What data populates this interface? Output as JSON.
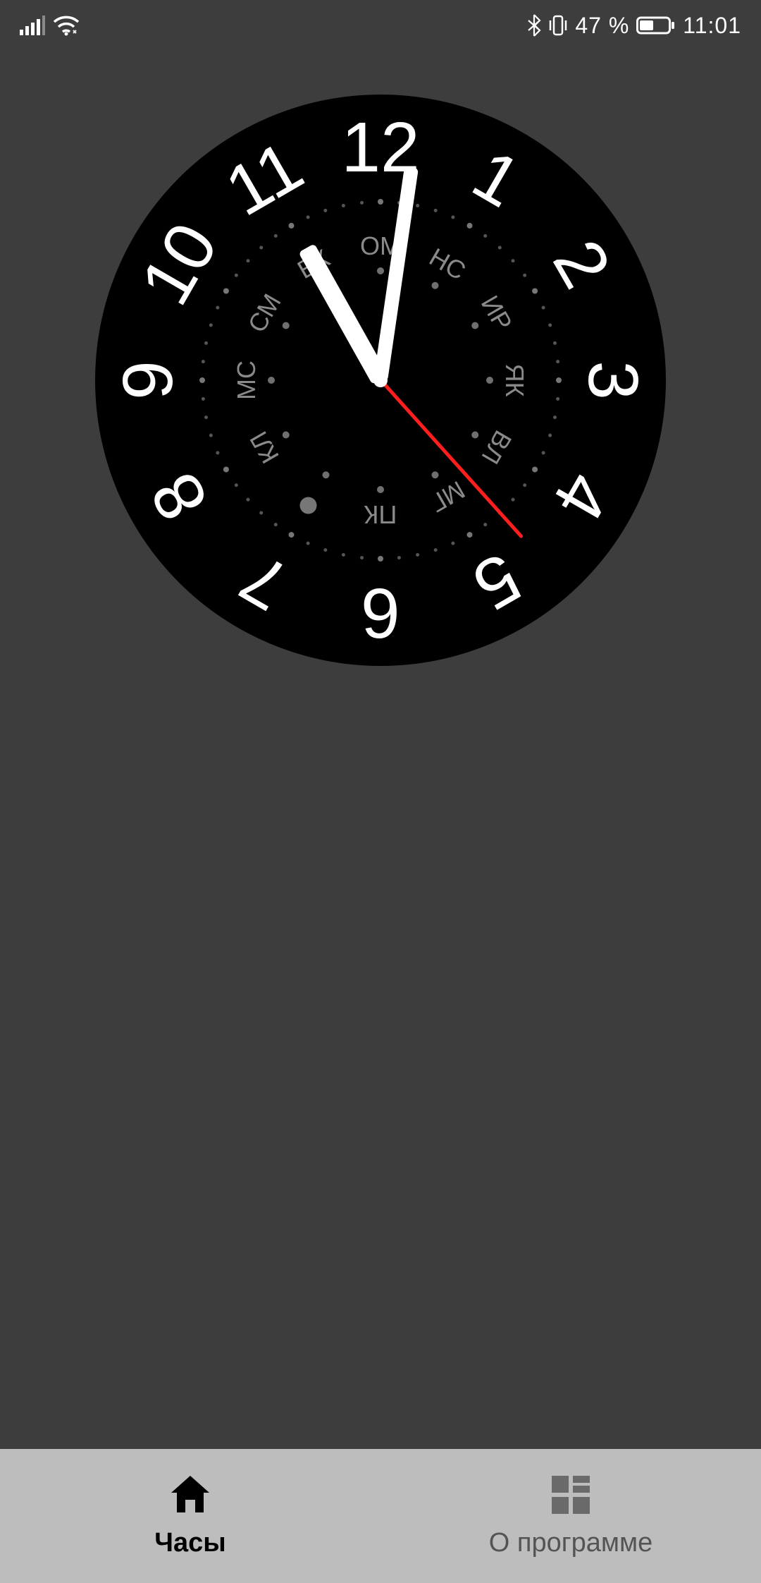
{
  "status": {
    "battery_percent": "47 %",
    "time": "11:01"
  },
  "clock": {
    "numerals": [
      "12",
      "1",
      "2",
      "3",
      "4",
      "5",
      "6",
      "7",
      "8",
      "9",
      "10",
      "11"
    ],
    "inner_labels": [
      "ОМ",
      "НС",
      "ИР",
      "ЯК",
      "ВЛ",
      "МГ",
      "ПК",
      "",
      "КЛ",
      "МС",
      "СМ",
      "ЕК"
    ],
    "time": {
      "hour": 11,
      "minute": 1,
      "second": 23
    },
    "lone_dot_slot": 7
  },
  "nav": {
    "items": [
      {
        "label": "Часы",
        "icon": "home",
        "active": true
      },
      {
        "label": "О программе",
        "icon": "grid",
        "active": false
      }
    ]
  }
}
